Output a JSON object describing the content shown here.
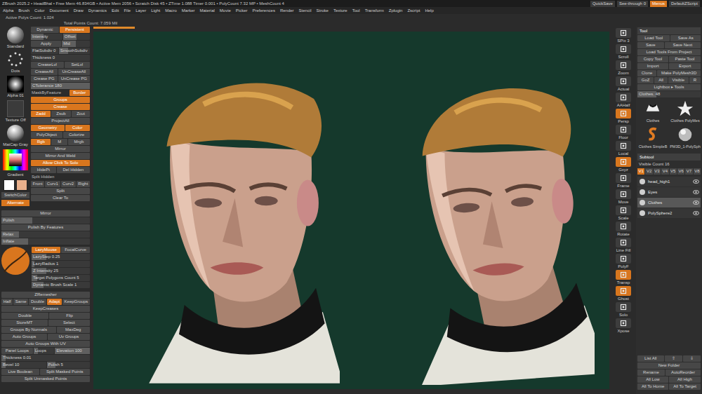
{
  "title_bar": {
    "text": "ZBrush 2025.2 • HeadBhal • Free Mem 46.834GB • Active Mem 2056 • Scratch Disk 45 • ZTime 1.088 Timer 0.001 • PolyCount 7.32 MP • MeshCount 4",
    "right": [
      {
        "label": "QuickSave",
        "selected": false
      },
      {
        "label": "See-through 0",
        "selected": false
      },
      {
        "label": "Menus",
        "selected": true
      },
      {
        "label": "DefaultZScript",
        "selected": false
      }
    ]
  },
  "menu": [
    "Alpha",
    "Brush",
    "Color",
    "Document",
    "Draw",
    "Dynamics",
    "Edit",
    "File",
    "Layer",
    "Light",
    "Macro",
    "Marker",
    "Material",
    "Movie",
    "Picker",
    "Preferences",
    "Render",
    "Stencil",
    "Stroke",
    "Texture",
    "Tool",
    "Transform",
    "Zplugin",
    "Zscript",
    "Help"
  ],
  "info": [
    "Active Polys Count: 1.024",
    "Total Points Count: 7.059 Mil"
  ],
  "left_panel": {
    "thumbs": [
      {
        "label": "Standard",
        "kind": "brush"
      },
      {
        "label": "Dots",
        "kind": "stroke"
      },
      {
        "label": "Alpha 01",
        "kind": "alpha"
      },
      {
        "label": "Texture Off",
        "kind": "texture"
      },
      {
        "label": "MatCap Gray",
        "kind": "material"
      }
    ],
    "color": {
      "label": "Gradient",
      "swatches": [
        {
          "color": "#ffffff"
        },
        {
          "color": "#e9b08c"
        }
      ],
      "buttons": [
        {
          "label": "SwitchColor",
          "selected": false
        },
        {
          "label": "Alternate",
          "selected": true
        }
      ]
    },
    "controls": [
      [
        {
          "kind": "button",
          "label": "Dynamic",
          "selected": false
        },
        {
          "kind": "button",
          "label": "Persistent",
          "selected": true
        }
      ],
      [
        {
          "kind": "slider",
          "label": "Intensity",
          "level": 0.4
        },
        {
          "kind": "slider",
          "label": "Offset",
          "level": 0.5
        }
      ],
      [
        {
          "kind": "button",
          "label": "Apply",
          "selected": false
        },
        {
          "kind": "slider",
          "label": "Mid",
          "level": 0.5
        }
      ],
      [
        {
          "kind": "slider",
          "label": "FlatSubdiv 0",
          "level": 0
        },
        {
          "kind": "slider",
          "label": "SmoothSubdiv",
          "level": 0.3
        }
      ],
      [
        {
          "kind": "slider",
          "label": "Thickness 0",
          "level": 0
        }
      ],
      [
        {
          "kind": "button",
          "label": "CreaseLvl",
          "selected": false
        },
        {
          "kind": "button",
          "label": "SetLvl",
          "selected": false
        }
      ],
      [
        {
          "kind": "button",
          "label": "CreaseAll",
          "selected": false
        },
        {
          "kind": "button",
          "label": "UnCreaseAll",
          "selected": false
        }
      ],
      [
        {
          "kind": "button",
          "label": "Crease PG",
          "selected": false
        },
        {
          "kind": "button",
          "label": "UnCrease PG",
          "selected": false
        }
      ],
      [
        {
          "kind": "slider",
          "label": "CTolerance 180",
          "level": 1
        }
      ],
      [
        {
          "kind": "label",
          "label": "MaskByFeature"
        },
        {
          "kind": "button",
          "label": "Border",
          "selected": true
        }
      ],
      [
        {
          "kind": "button",
          "label": "Groups",
          "selected": true
        }
      ],
      [
        {
          "kind": "button",
          "label": "Crease",
          "selected": true
        }
      ],
      [
        {
          "kind": "button",
          "label": "Zadd",
          "selected": true
        },
        {
          "kind": "button",
          "label": "Zsub",
          "selected": false
        },
        {
          "kind": "button",
          "label": "Zcut",
          "selected": false
        }
      ],
      [
        {
          "kind": "button",
          "label": "ProjectAll",
          "selected": false
        }
      ],
      [
        {
          "kind": "button",
          "label": "Geometry",
          "selected": true
        },
        {
          "kind": "button",
          "label": "Color",
          "selected": true
        }
      ],
      [
        {
          "kind": "button",
          "label": "PolyObject",
          "selected": false
        },
        {
          "kind": "button",
          "label": "Colorize",
          "selected": false
        }
      ],
      [
        {
          "kind": "button",
          "label": "Rgb",
          "selected": true
        },
        {
          "kind": "button",
          "label": "M",
          "selected": false
        },
        {
          "kind": "button",
          "label": "Mrgb",
          "selected": false
        }
      ],
      [
        {
          "kind": "button",
          "label": "Mirror",
          "selected": false
        }
      ],
      [
        {
          "kind": "button",
          "label": "Mirror And Weld",
          "selected": false
        }
      ],
      [
        {
          "kind": "button",
          "label": "Allow Click To Solo",
          "selected": true
        }
      ],
      [
        {
          "kind": "button",
          "label": "HidePt",
          "selected": false
        },
        {
          "kind": "button",
          "label": "Del Hidden",
          "selected": false
        }
      ],
      [
        {
          "kind": "label",
          "label": "Split Hidden"
        }
      ],
      [
        {
          "kind": "button",
          "label": "Front",
          "selected": false
        },
        {
          "kind": "button",
          "label": "Curv1",
          "selected": false
        },
        {
          "kind": "button",
          "label": "Curv2",
          "selected": false
        },
        {
          "kind": "button",
          "label": "Right",
          "selected": false
        }
      ],
      [
        {
          "kind": "button",
          "label": "Split",
          "selected": false
        }
      ],
      [
        {
          "kind": "button",
          "label": "Clear To",
          "selected": false
        }
      ]
    ],
    "rows_a": [
      [
        {
          "kind": "button",
          "label": "Mirror",
          "selected": false
        }
      ],
      [
        {
          "kind": "slider",
          "label": "Polish",
          "level": 0.35
        }
      ],
      [
        {
          "kind": "button",
          "label": "Polish By Features",
          "selected": false
        }
      ],
      [
        {
          "kind": "slider",
          "label": "Relax",
          "level": 0.2
        }
      ],
      [
        {
          "kind": "slider",
          "label": "Inflate",
          "level": 0.3
        }
      ]
    ],
    "lazy": {
      "curve_level": 0.6,
      "rows": [
        [
          {
            "kind": "button",
            "label": "LazyMouse",
            "selected": true
          },
          {
            "kind": "button",
            "label": "FocalCurve",
            "selected": false
          }
        ],
        [
          {
            "kind": "slider",
            "label": "LazyStep 0.25",
            "level": 0.25
          }
        ],
        [
          {
            "kind": "slider",
            "label": "LazyRadius 1",
            "level": 0.05
          }
        ],
        [
          {
            "kind": "slider",
            "label": "Z Intensity 25",
            "level": 0.25
          }
        ],
        [
          {
            "kind": "slider",
            "label": "Target Polygons Count 5",
            "level": 0.1
          }
        ],
        [
          {
            "kind": "slider",
            "label": "Dynamic Brush Scale 1",
            "level": 0.2
          }
        ]
      ]
    },
    "rows_b": [
      [
        {
          "kind": "button",
          "label": "ZRemesher",
          "selected": false
        }
      ],
      [
        {
          "kind": "button",
          "label": "Half",
          "selected": false
        },
        {
          "kind": "button",
          "label": "Same",
          "selected": false
        },
        {
          "kind": "button",
          "label": "Double",
          "selected": false
        },
        {
          "kind": "button",
          "label": "Adapt",
          "selected": true
        },
        {
          "kind": "button",
          "label": "KeepGroups",
          "selected": false
        }
      ],
      [
        {
          "kind": "button",
          "label": "KeepCreases",
          "selected": false
        }
      ],
      [
        {
          "kind": "button",
          "label": "Double",
          "selected": false
        },
        {
          "kind": "button",
          "label": "Flip",
          "selected": false
        }
      ],
      [
        {
          "kind": "button",
          "label": "StoreMT",
          "selected": false
        },
        {
          "kind": "button",
          "label": "Select",
          "selected": false
        }
      ],
      [
        {
          "kind": "button",
          "label": "Groups By Normals",
          "selected": false
        },
        {
          "kind": "button",
          "label": "MaxDeg",
          "selected": false
        }
      ],
      [
        {
          "kind": "button",
          "label": "Auto Groups",
          "selected": false
        },
        {
          "kind": "button",
          "label": "Uv Groups",
          "selected": false
        }
      ],
      [
        {
          "kind": "button",
          "label": "Auto Groups With UV",
          "selected": false
        }
      ],
      [
        {
          "kind": "button",
          "label": "Panel Loops",
          "selected": false
        },
        {
          "kind": "slider",
          "label": "Loops",
          "level": 0.2
        },
        {
          "kind": "slider",
          "label": "Elevation 100",
          "level": 1
        }
      ],
      [
        {
          "kind": "slider",
          "label": "Thickness 0.01",
          "level": 0.05
        }
      ],
      [
        {
          "kind": "slider",
          "label": "Bevel 10",
          "level": 0.1
        },
        {
          "kind": "slider",
          "label": "Polish 5",
          "level": 0.2
        }
      ],
      [
        {
          "kind": "button",
          "label": "Live Boolean",
          "selected": false
        },
        {
          "kind": "button",
          "label": "Split Masked Points",
          "selected": false
        }
      ],
      [
        {
          "kind": "button",
          "label": "Split Unmasked Points",
          "selected": false
        }
      ]
    ]
  },
  "canvas": {
    "progress_level": 0.08
  },
  "shelf": [
    {
      "label": "SPix 3",
      "selected": false
    },
    {
      "label": "Scroll",
      "selected": false
    },
    {
      "label": "Zoom",
      "selected": false
    },
    {
      "label": "Actual",
      "selected": false
    },
    {
      "label": "AAHalf",
      "selected": false
    },
    {
      "label": "Persp",
      "selected": true
    },
    {
      "label": "Floor",
      "selected": false
    },
    {
      "label": "Local",
      "selected": false
    },
    {
      "label": "Gxyz",
      "selected": true
    },
    {
      "label": "Frame",
      "selected": false
    },
    {
      "label": "Move",
      "selected": false
    },
    {
      "label": "Scale",
      "selected": false
    },
    {
      "label": "Rotate",
      "selected": false
    },
    {
      "label": "Line Fill",
      "selected": false
    },
    {
      "label": "PolyF",
      "selected": false
    },
    {
      "label": "Transp",
      "selected": true
    },
    {
      "label": "Ghost",
      "selected": true
    },
    {
      "label": "Solo",
      "selected": false
    },
    {
      "label": "Xpose",
      "selected": false
    }
  ],
  "tool": {
    "title": "Tool",
    "rows": [
      [
        {
          "kind": "button",
          "label": "Load Tool",
          "selected": false
        },
        {
          "kind": "button",
          "label": "Save As",
          "selected": false
        }
      ],
      [
        {
          "kind": "button",
          "label": "Save",
          "selected": false
        },
        {
          "kind": "button",
          "label": "Save Next",
          "selected": false
        }
      ],
      [
        {
          "kind": "button",
          "label": "Load Tools From Project",
          "selected": false
        }
      ],
      [
        {
          "kind": "button",
          "label": "Copy Tool",
          "selected": false
        },
        {
          "kind": "button",
          "label": "Paste Tool",
          "selected": false
        }
      ],
      [
        {
          "kind": "button",
          "label": "Import",
          "selected": false
        },
        {
          "kind": "button",
          "label": "Export",
          "selected": false
        }
      ],
      [
        {
          "kind": "button",
          "label": "Clone",
          "selected": false
        },
        {
          "kind": "button",
          "label": "Make PolyMesh3D",
          "selected": false
        }
      ],
      [
        {
          "kind": "button",
          "label": "GoZ",
          "selected": false
        },
        {
          "kind": "button",
          "label": "All",
          "selected": false
        },
        {
          "kind": "button",
          "label": "Visible",
          "selected": false
        },
        {
          "kind": "button",
          "label": "R",
          "selected": false
        }
      ],
      [
        {
          "kind": "button",
          "label": "Lightbox ▸ Tools",
          "selected": false
        }
      ],
      [
        {
          "kind": "slider",
          "label": "Clothes. 48",
          "level": 0.3
        }
      ]
    ],
    "thumbs": [
      {
        "label": "Clothes",
        "kind": "shirt"
      },
      {
        "label": "Clothes PolyMes",
        "kind": "star"
      },
      {
        "label": "Clothes SimpleB",
        "kind": "logo"
      },
      {
        "label": "PM3D_1-PolySph",
        "kind": "sphere"
      }
    ]
  },
  "subtool": {
    "title": "Subtool",
    "visible_count": "Visible Count 16",
    "tabs": [
      {
        "label": "V1",
        "selected": true
      },
      {
        "label": "V2",
        "selected": false
      },
      {
        "label": "V3",
        "selected": false
      },
      {
        "label": "V4",
        "selected": false
      },
      {
        "label": "V5",
        "selected": false
      },
      {
        "label": "V6",
        "selected": false
      },
      {
        "label": "V7",
        "selected": false
      },
      {
        "label": "V8",
        "selected": false
      }
    ],
    "items": [
      {
        "name": "head_high1",
        "selected": false
      },
      {
        "name": "Eyes",
        "selected": false
      },
      {
        "name": "Clothes",
        "selected": true
      },
      {
        "name": "PolySphere2",
        "selected": false
      }
    ],
    "bottom": [
      [
        {
          "kind": "button",
          "label": "List All",
          "selected": false
        },
        {
          "kind": "button",
          "label": "⇧",
          "selected": false
        },
        {
          "kind": "button",
          "label": "⇩",
          "selected": false
        }
      ],
      [
        {
          "kind": "button",
          "label": "New Folder",
          "selected": false
        }
      ],
      [
        {
          "kind": "button",
          "label": "Rename",
          "selected": false
        },
        {
          "kind": "button",
          "label": "AutoReorder",
          "selected": false
        }
      ],
      [
        {
          "kind": "button",
          "label": "All Low",
          "selected": false
        },
        {
          "kind": "button",
          "label": "All High",
          "selected": false
        }
      ],
      [
        {
          "kind": "button",
          "label": "All To Home",
          "selected": false
        },
        {
          "kind": "button",
          "label": "All To Target",
          "selected": false
        }
      ]
    ]
  }
}
